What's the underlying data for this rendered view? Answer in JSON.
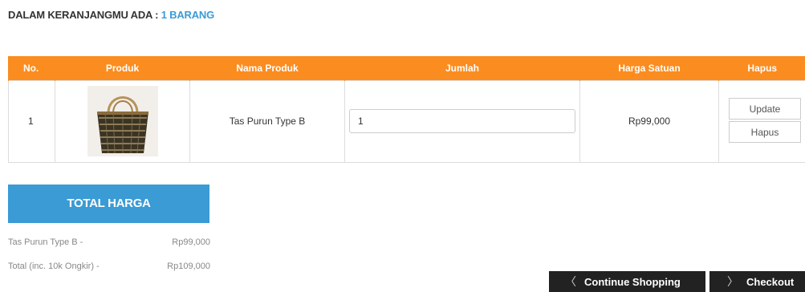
{
  "cart": {
    "heading_prefix": "DALAM KERANJANGMU ADA :",
    "heading_count": "1 BARANG"
  },
  "table": {
    "headers": [
      "No.",
      "Produk",
      "Nama Produk",
      "Jumlah",
      "Harga Satuan",
      "Hapus"
    ],
    "rows": [
      {
        "no": "1",
        "product_image": "woven-handbag-photo",
        "name": "Tas Purun Type B",
        "quantity": "1",
        "unit_price": "Rp99,000",
        "update_label": "Update",
        "delete_label": "Hapus"
      }
    ]
  },
  "total": {
    "title": "TOTAL HARGA",
    "lines": [
      {
        "label": "Tas Purun Type B -",
        "value": "Rp99,000"
      },
      {
        "label": "Total (inc. 10k Ongkir) -",
        "value": "Rp109,000"
      }
    ]
  },
  "buttons": {
    "continue_label": "Continue Shopping",
    "checkout_label": "Checkout",
    "continue_icon": "chevron-left-icon",
    "checkout_icon": "chevron-right-icon"
  },
  "colors": {
    "header_orange": "#fb8c1f",
    "accent_blue": "#3a9bd5",
    "button_dark": "#222222"
  }
}
